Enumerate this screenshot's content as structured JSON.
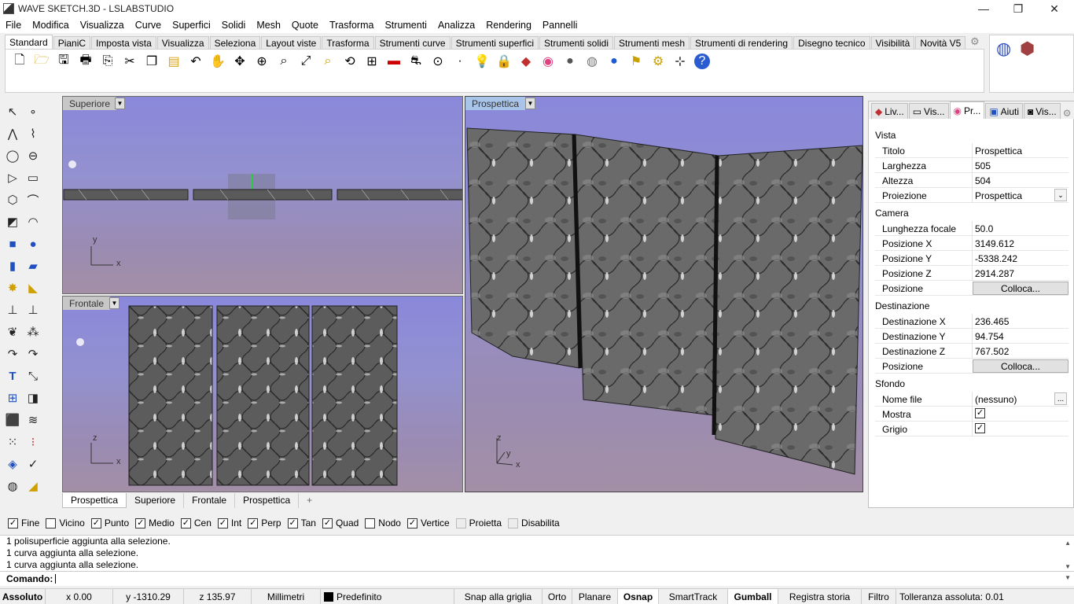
{
  "window": {
    "title": "WAVE SKETCH.3D - LSLABSTUDIO",
    "minimize": "—",
    "maximize": "❐",
    "close": "✕"
  },
  "menu": [
    "File",
    "Modifica",
    "Visualizza",
    "Curve",
    "Superfici",
    "Solidi",
    "Mesh",
    "Quote",
    "Trasforma",
    "Strumenti",
    "Analizza",
    "Rendering",
    "Pannelli"
  ],
  "toolbar_tabs": [
    "Standard",
    "PianiC",
    "Imposta vista",
    "Visualizza",
    "Seleziona",
    "Layout viste",
    "Trasforma",
    "Strumenti curve",
    "Strumenti superfici",
    "Strumenti solidi",
    "Strumenti mesh",
    "Strumenti di rendering",
    "Disegno tecnico",
    "Visibilità",
    "Novità V5"
  ],
  "viewports": {
    "top": {
      "label": "Superiore",
      "axis_y": "y",
      "axis_x": "x"
    },
    "front": {
      "label": "Frontale",
      "axis_y": "z",
      "axis_x": "x"
    },
    "perspective": {
      "label": "Prospettica",
      "axis_z": "z",
      "axis_y": "y",
      "axis_x": "x"
    }
  },
  "view_tabs": [
    "Prospettica",
    "Superiore",
    "Frontale",
    "Prospettica"
  ],
  "view_tabs_add": "+",
  "panel_tabs": [
    "Liv...",
    "Vis...",
    "Pr...",
    "Aiuti",
    "Vis..."
  ],
  "properties": {
    "vista": "Vista",
    "titolo_label": "Titolo",
    "titolo": "Prospettica",
    "larghezza_label": "Larghezza",
    "larghezza": "505",
    "altezza_label": "Altezza",
    "altezza": "504",
    "proiezione_label": "Proiezione",
    "proiezione": "Prospettica",
    "camera": "Camera",
    "focale_label": "Lunghezza focale",
    "focale": "50.0",
    "posx_label": "Posizione X",
    "posx": "3149.612",
    "posy_label": "Posizione Y",
    "posy": "-5338.242",
    "posz_label": "Posizione Z",
    "posz": "2914.287",
    "pos_label": "Posizione",
    "colloca": "Colloca...",
    "destinazione": "Destinazione",
    "destx_label": "Destinazione X",
    "destx": "236.465",
    "desty_label": "Destinazione Y",
    "desty": "94.754",
    "destz_label": "Destinazione Z",
    "destz": "767.502",
    "sfondo": "Sfondo",
    "nomefile_label": "Nome file",
    "nomefile": "(nessuno)",
    "browse": "...",
    "mostra_label": "Mostra",
    "grigio_label": "Grigio"
  },
  "osnap": [
    {
      "label": "Fine",
      "checked": true
    },
    {
      "label": "Vicino",
      "checked": false
    },
    {
      "label": "Punto",
      "checked": true
    },
    {
      "label": "Medio",
      "checked": true
    },
    {
      "label": "Cen",
      "checked": true
    },
    {
      "label": "Int",
      "checked": true
    },
    {
      "label": "Perp",
      "checked": true
    },
    {
      "label": "Tan",
      "checked": true
    },
    {
      "label": "Quad",
      "checked": true
    },
    {
      "label": "Nodo",
      "checked": false
    },
    {
      "label": "Vertice",
      "checked": true
    },
    {
      "label": "Proietta",
      "checked": false,
      "disabled": true
    },
    {
      "label": "Disabilita",
      "checked": false,
      "disabled": true
    }
  ],
  "command_history": [
    "1 polisuperficie aggiunta alla selezione.",
    "1 curva aggiunta alla selezione.",
    "1 curva aggiunta alla selezione."
  ],
  "command_prompt": "Comando:",
  "status": {
    "assoluto": "Assoluto",
    "x": "x 0.00",
    "y": "y -1310.29",
    "z": "z 135.97",
    "unita": "Millimetri",
    "layer": "Predefinito",
    "snap": "Snap alla griglia",
    "orto": "Orto",
    "planare": "Planare",
    "osnap": "Osnap",
    "smarttrack": "SmartTrack",
    "gumball": "Gumball",
    "storia": "Registra storia",
    "filtro": "Filtro",
    "tolleranza": "Tolleranza assoluta: 0.01"
  },
  "colors": {
    "viewport_top": "#8a88da",
    "viewport_bottom": "#a38fa6",
    "surface": "#5a5a5a"
  }
}
